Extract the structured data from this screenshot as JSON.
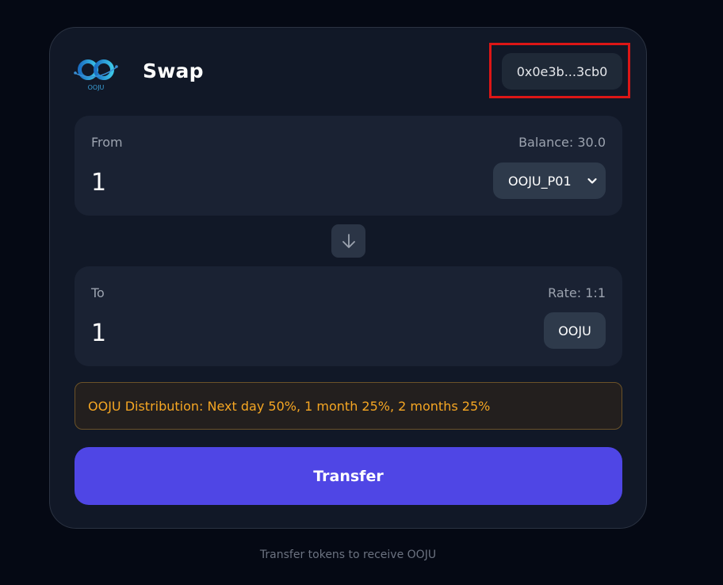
{
  "header": {
    "title": "Swap",
    "logo_text": "OOJU",
    "wallet_address": "0x0e3b...3cb0"
  },
  "from_panel": {
    "label": "From",
    "balance": "Balance: 30.0",
    "amount": "1",
    "token": "OOJU_P01"
  },
  "to_panel": {
    "label": "To",
    "rate": "Rate: 1:1",
    "amount": "1",
    "token": "OOJU"
  },
  "notice": "OOJU Distribution: Next day 50%, 1 month 25%, 2 months 25%",
  "transfer_button": "Transfer",
  "footer": "Transfer tokens to receive OOJU",
  "icons": {
    "logo": "ooju-logo-icon",
    "swap": "arrow-down-icon",
    "dropdown": "chevron-down-icon"
  },
  "colors": {
    "accent": "#4f46e5",
    "notice_text": "#f5a623",
    "highlight": "#dc1616"
  }
}
